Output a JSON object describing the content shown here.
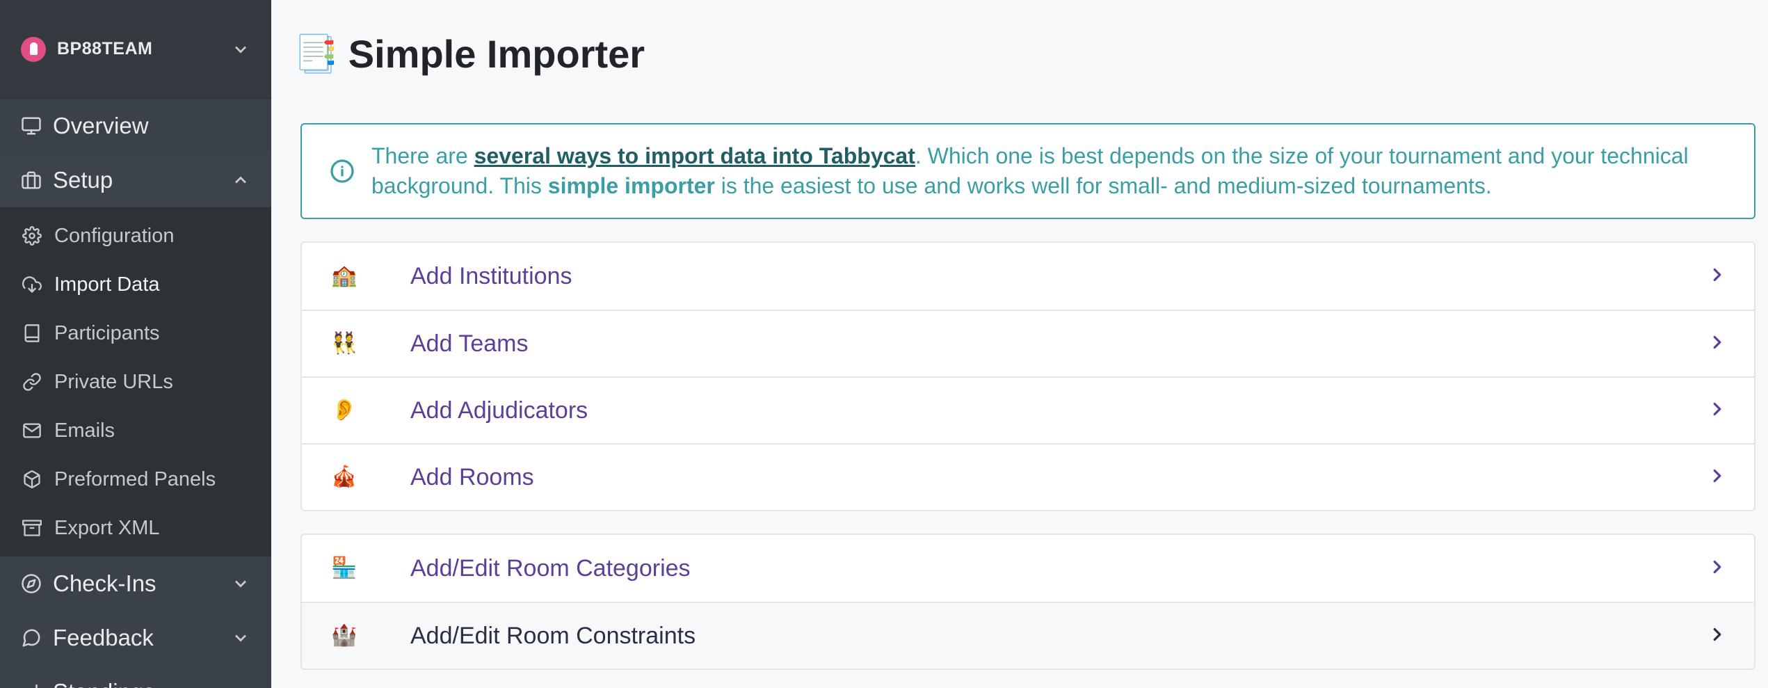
{
  "sidebar": {
    "brand": "BP88TEAM",
    "sections_top": [
      {
        "label": "Overview",
        "icon": "monitor-icon"
      },
      {
        "label": "Setup",
        "icon": "briefcase-icon"
      }
    ],
    "setup_items": [
      {
        "label": "Configuration",
        "icon": "gear-icon"
      },
      {
        "label": "Import Data",
        "icon": "cloud-download-icon"
      },
      {
        "label": "Participants",
        "icon": "book-icon"
      },
      {
        "label": "Private URLs",
        "icon": "link-icon"
      },
      {
        "label": "Emails",
        "icon": "mail-icon"
      },
      {
        "label": "Preformed Panels",
        "icon": "box-icon"
      },
      {
        "label": "Export XML",
        "icon": "archive-icon"
      }
    ],
    "sections_bottom": [
      {
        "label": "Check-Ins",
        "icon": "compass-icon"
      },
      {
        "label": "Feedback",
        "icon": "message-icon"
      },
      {
        "label": "Standings",
        "icon": "bar-chart-icon"
      }
    ]
  },
  "page": {
    "emoji": "📑",
    "title": "Simple Importer"
  },
  "alert": {
    "prefix": "There are ",
    "link": "several ways to import data into Tabbycat",
    "middle": ". Which one is best depends on the size of your tournament and your technical background. This ",
    "bold": "simple importer",
    "suffix": " is the easiest to use and works well for small- and medium-sized tournaments."
  },
  "import_items": [
    {
      "emoji": "🏫",
      "label": "Add Institutions"
    },
    {
      "emoji": "👯",
      "label": "Add Teams"
    },
    {
      "emoji": "👂",
      "label": "Add Adjudicators"
    },
    {
      "emoji": "🎪",
      "label": "Add Rooms"
    }
  ],
  "room_items": [
    {
      "emoji": "🏪",
      "label": "Add/Edit Room Categories"
    },
    {
      "emoji": "🏰",
      "label": "Add/Edit Room Constraints"
    }
  ]
}
